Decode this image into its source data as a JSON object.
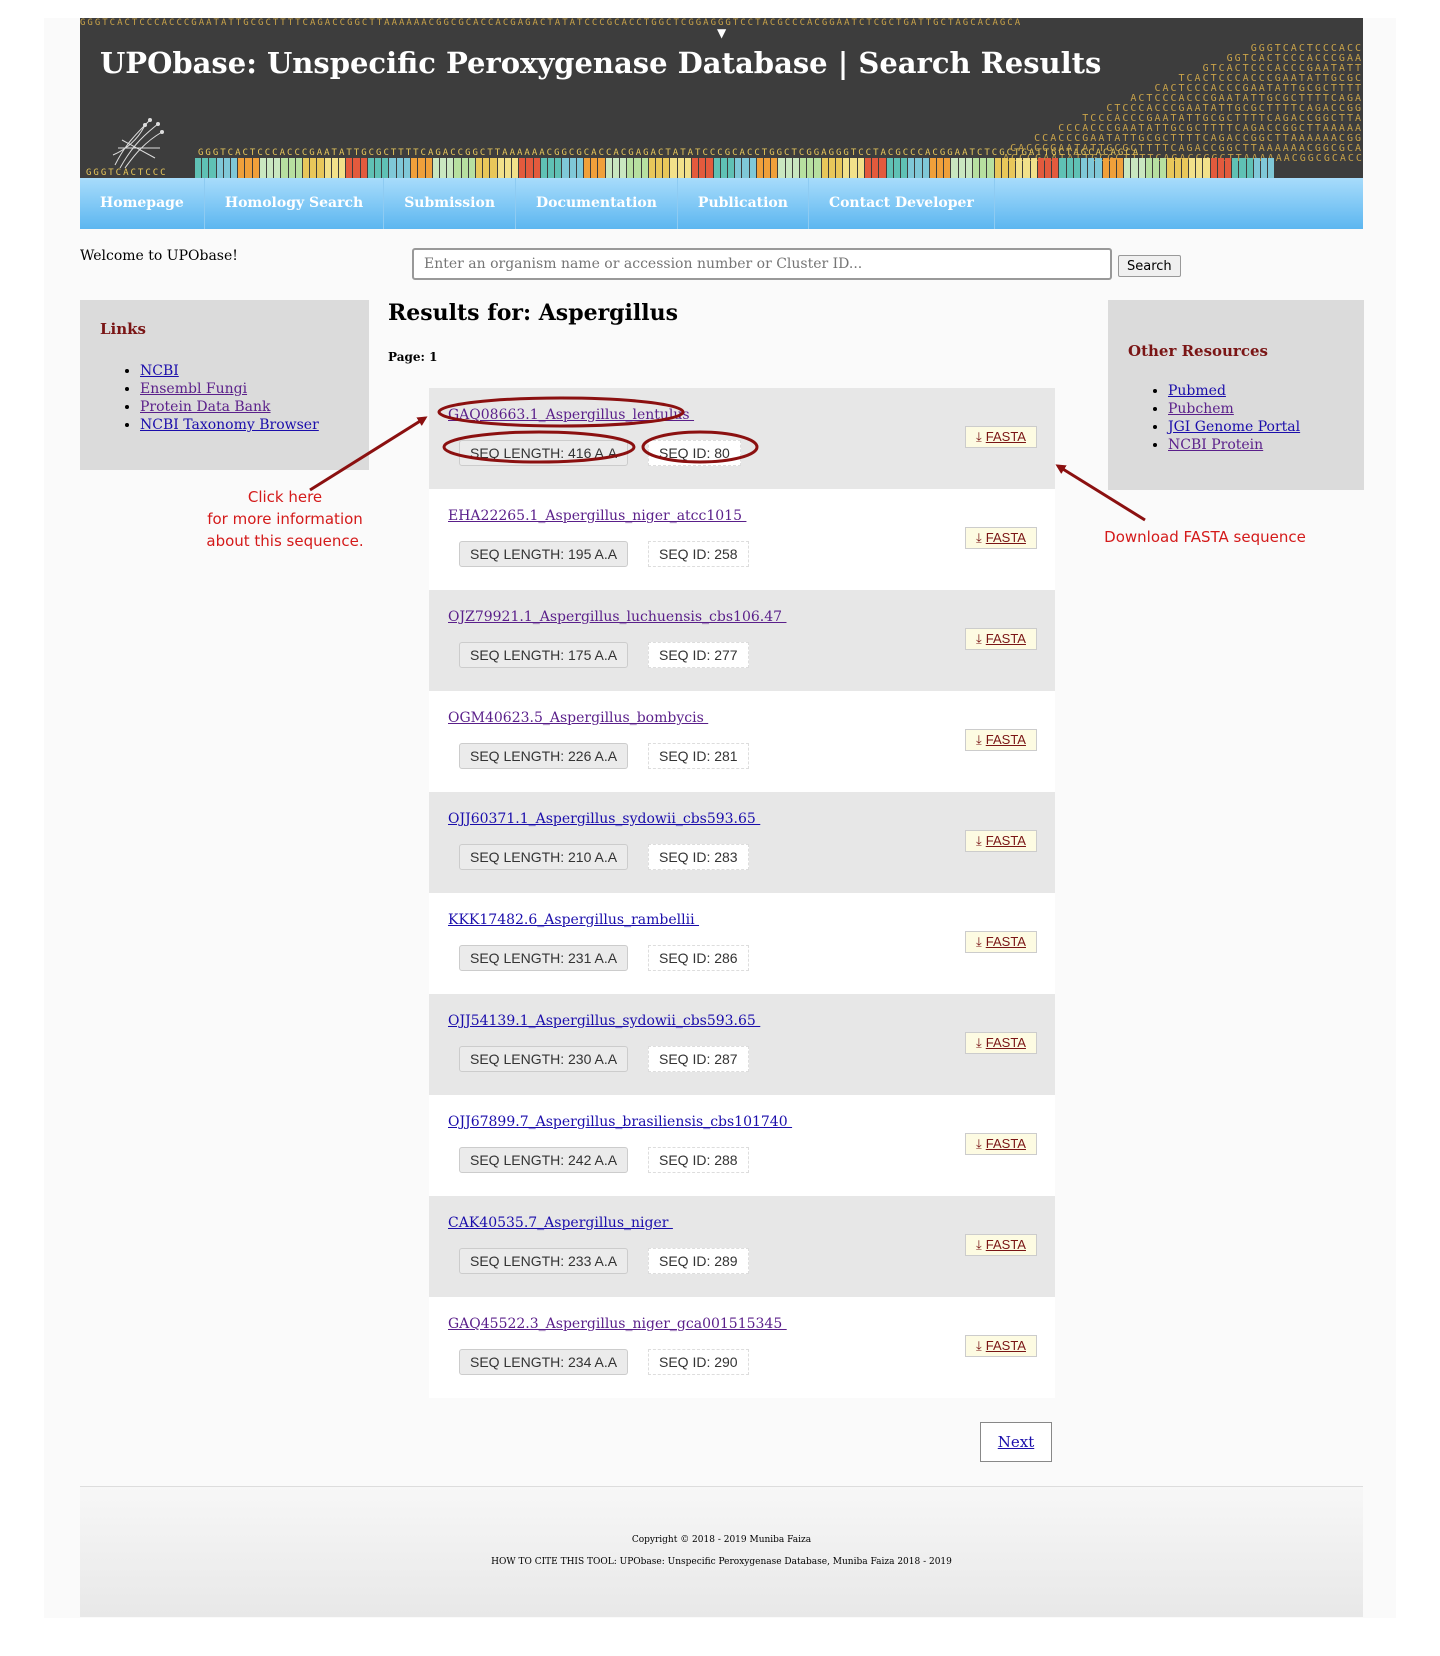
{
  "header": {
    "title": "UPObase: Unspecific Peroxygenase Database | Search Results",
    "dna_text": "GGGTCACTCCCACCCGAATATTGCGCTTTTCAGACCGGCTTAAAAAACGGCGCACCACGAGACTATATCCCGCACCTGGCTCGGAGGGTCCTACGCCCACGGAATCTCGCTGATTGCTAGCACAGCA"
  },
  "nav": {
    "items": [
      "Homepage",
      "Homology Search",
      "Submission",
      "Documentation",
      "Publication",
      "Contact Developer"
    ]
  },
  "welcome": "Welcome to UPObase!",
  "search": {
    "placeholder": "Enter an organism name or accession number or Cluster ID...",
    "button": "Search"
  },
  "links": {
    "title": "Links",
    "items": [
      "NCBI",
      "Ensembl Fungi",
      "Protein Data Bank",
      "NCBI Taxonomy Browser"
    ]
  },
  "resources": {
    "title": "Other Resources",
    "items": [
      "Pubmed",
      "Pubchem",
      "JGI Genome Portal",
      "NCBI Protein"
    ]
  },
  "results": {
    "title": "Results for: Aspergillus",
    "page": "Page: 1",
    "fasta_label": "FASTA",
    "items": [
      {
        "title": "GAQ08663.1_Aspergillus_lentulus ",
        "length": "SEQ LENGTH: 416 A.A",
        "id": "SEQ ID: 80"
      },
      {
        "title": "EHA22265.1_Aspergillus_niger_atcc1015 ",
        "length": "SEQ LENGTH: 195 A.A",
        "id": "SEQ ID: 258"
      },
      {
        "title": "OJZ79921.1_Aspergillus_luchuensis_cbs106.47 ",
        "length": "SEQ LENGTH: 175 A.A",
        "id": "SEQ ID: 277"
      },
      {
        "title": "OGM40623.5_Aspergillus_bombycis ",
        "length": "SEQ LENGTH: 226 A.A",
        "id": "SEQ ID: 281"
      },
      {
        "title": "OJJ60371.1_Aspergillus_sydowii_cbs593.65 ",
        "length": "SEQ LENGTH: 210 A.A",
        "id": "SEQ ID: 283"
      },
      {
        "title": "KKK17482.6_Aspergillus_rambellii ",
        "length": "SEQ LENGTH: 231 A.A",
        "id": "SEQ ID: 286"
      },
      {
        "title": "OJJ54139.1_Aspergillus_sydowii_cbs593.65 ",
        "length": "SEQ LENGTH: 230 A.A",
        "id": "SEQ ID: 287"
      },
      {
        "title": "OJJ67899.7_Aspergillus_brasiliensis_cbs101740 ",
        "length": "SEQ LENGTH: 242 A.A",
        "id": "SEQ ID: 288"
      },
      {
        "title": "CAK40535.7_Aspergillus_niger ",
        "length": "SEQ LENGTH: 233 A.A",
        "id": "SEQ ID: 289"
      },
      {
        "title": "GAQ45522.3_Aspergillus_niger_gca001515345 ",
        "length": "SEQ LENGTH: 234 A.A",
        "id": "SEQ ID: 290"
      }
    ],
    "next": "Next"
  },
  "footer": {
    "copyright": "Copyright © 2018 - 2019 Muniba Faiza",
    "cite": "HOW TO CITE THIS TOOL: UPObase: Unspecific Peroxygenase Database, Muniba Faiza 2018 - 2019"
  },
  "annotations": {
    "click_here": [
      "Click here",
      "for more information",
      "about this sequence."
    ],
    "download": "Download FASTA sequence",
    "color": "#c41a1a"
  },
  "colors": {
    "banner_bg": "#3d3d3d",
    "nav_top": "#a8dcfb",
    "nav_bottom": "#5cb6f0",
    "sidebox_bg": "#dbdbdb",
    "heading_red": "#7a1515",
    "link_blue": "#1a0dab",
    "link_visited": "#5a1f8a"
  }
}
